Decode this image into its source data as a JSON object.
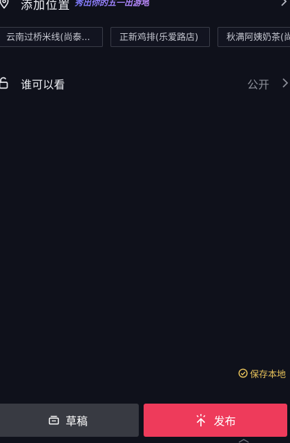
{
  "location": {
    "title": "添加位置",
    "promo": "秀出你的五一出游地",
    "icon": "map-pin-icon"
  },
  "poi_chips": [
    {
      "label": "云南过桥米线(尚泰..."
    },
    {
      "label": "正新鸡排(乐爱路店)"
    },
    {
      "label": "秋满阿姨奶茶(尚"
    }
  ],
  "visibility": {
    "label": "谁可以看",
    "value": "公开",
    "icon": "unlock-icon"
  },
  "save_local": {
    "label": "保存本地",
    "icon": "check-circle-icon",
    "color": "#e6c15a"
  },
  "actions": {
    "draft_label": "草稿",
    "draft_icon": "draft-box-icon",
    "publish_label": "发布",
    "publish_icon": "spark-arrow-up-icon",
    "publish_color": "#ee3b5b",
    "draft_color": "#383a42"
  }
}
